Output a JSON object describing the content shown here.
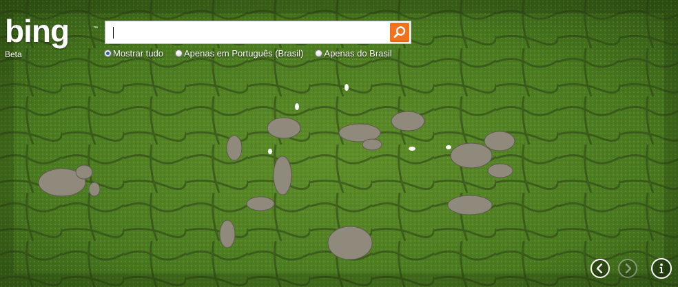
{
  "logo": {
    "text": "bing",
    "badge": "Beta"
  },
  "search": {
    "value": "",
    "button_icon": "search-icon",
    "accent_color": "#f2711c"
  },
  "scope_options": [
    {
      "label": "Mostrar tudo",
      "checked": true
    },
    {
      "label": "Apenas em Português (Brasil)",
      "checked": false
    },
    {
      "label": "Apenas do Brasil",
      "checked": false
    }
  ],
  "controls": {
    "previous_icon": "chevron-left-icon",
    "next_icon": "chevron-right-icon",
    "next_enabled": false,
    "info_icon": "info-icon"
  },
  "background": {
    "subject": "aerial-elephant-herd-in-green-marsh"
  }
}
